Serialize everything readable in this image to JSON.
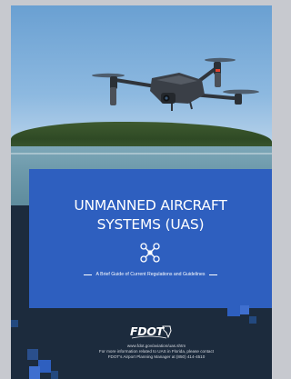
{
  "cover": {
    "title_line1": "UNMANNED AIRCRAFT",
    "title_line2": "SYSTEMS (UAS)",
    "subtitle": "A Brief Guide of Current Regulations and Guidelines",
    "logo_text": "FDOT",
    "footer": {
      "line1": "www.fdot.gov/aviation/uas.shtm",
      "line2": "For more information related to UAS in Florida, please contact",
      "line3": "FDOT's Airport Planning Manager at (850) 414-4510"
    }
  },
  "colors": {
    "panel_blue": "#2e5fbf",
    "navy": "#1c2b3d",
    "accent_light_blue": "#4a78d4",
    "drone_body": "#3a3f47",
    "drone_led": "#e0412e"
  },
  "icons": [
    "drone-icon",
    "fdot-logo"
  ]
}
